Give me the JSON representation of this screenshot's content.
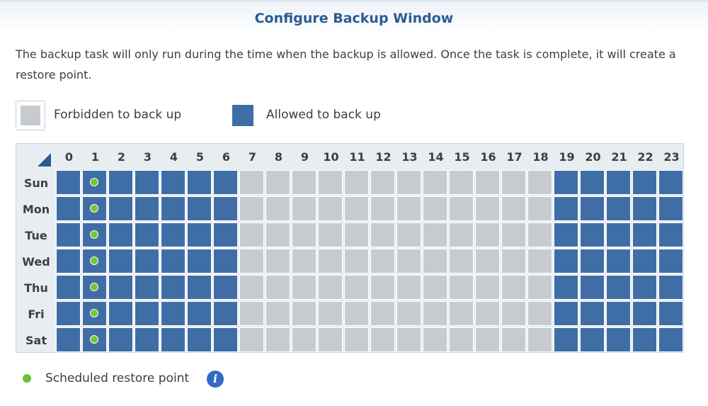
{
  "header": {
    "title": "Configure Backup Window"
  },
  "description": "The backup task will only run during the time when the backup is allowed. Once the task is complete, it will create a restore point.",
  "legend": {
    "forbidden_label": "Forbidden to back up",
    "allowed_label": "Allowed to back up"
  },
  "schedule": {
    "hours": [
      "0",
      "1",
      "2",
      "3",
      "4",
      "5",
      "6",
      "7",
      "8",
      "9",
      "10",
      "11",
      "12",
      "13",
      "14",
      "15",
      "16",
      "17",
      "18",
      "19",
      "20",
      "21",
      "22",
      "23"
    ],
    "days": [
      "Sun",
      "Mon",
      "Tue",
      "Wed",
      "Thu",
      "Fri",
      "Sat"
    ],
    "allowed_hours": [
      0,
      1,
      2,
      3,
      4,
      5,
      6,
      19,
      20,
      21,
      22,
      23
    ],
    "restore_point_hour": 1
  },
  "footer": {
    "restore_point_label": "Scheduled restore point",
    "info_icon": "i"
  },
  "colors": {
    "allowed": "#3f6ea6",
    "forbidden": "#c7cbd0",
    "restore_dot": "#79c23a",
    "title": "#2a5b91"
  }
}
